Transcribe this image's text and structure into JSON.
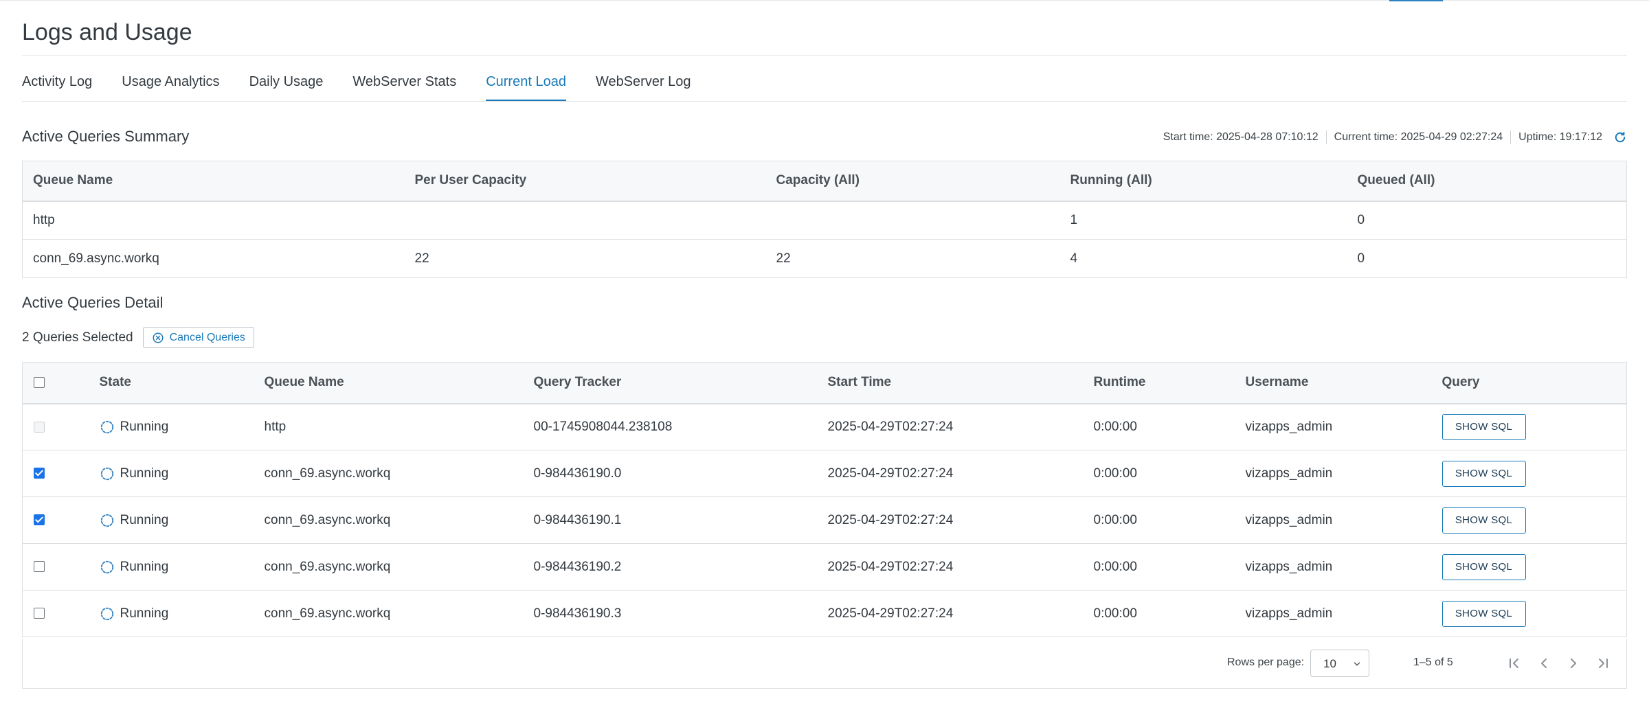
{
  "page": {
    "title": "Logs and Usage"
  },
  "tabs": [
    {
      "label": "Activity Log",
      "active": false
    },
    {
      "label": "Usage Analytics",
      "active": false
    },
    {
      "label": "Daily Usage",
      "active": false
    },
    {
      "label": "WebServer Stats",
      "active": false
    },
    {
      "label": "Current Load",
      "active": true
    },
    {
      "label": "WebServer Log",
      "active": false
    }
  ],
  "summary": {
    "title": "Active Queries Summary",
    "stats": {
      "start_time": "Start time: 2025-04-28 07:10:12",
      "current_time": "Current time: 2025-04-29 02:27:24",
      "uptime": "Uptime: 19:17:12",
      "refresh_icon": "refresh-icon"
    },
    "columns": [
      "Queue Name",
      "Per User Capacity",
      "Capacity (All)",
      "Running (All)",
      "Queued (All)"
    ],
    "rows": [
      [
        "http",
        "",
        "",
        "1",
        "0"
      ],
      [
        "conn_69.async.workq",
        "22",
        "22",
        "4",
        "0"
      ]
    ]
  },
  "detail": {
    "title": "Active Queries Detail",
    "selected_text": "2 Queries Selected",
    "cancel_label": "Cancel Queries",
    "columns": [
      "State",
      "Queue Name",
      "Query Tracker",
      "Start Time",
      "Runtime",
      "Username",
      "Query"
    ],
    "rows": [
      {
        "checked": false,
        "disabled": true,
        "state": "Running",
        "queue": "http",
        "tracker": "00-1745908044.238108",
        "start": "2025-04-29T02:27:24",
        "runtime": "0:00:00",
        "user": "vizapps_admin",
        "action": "SHOW SQL"
      },
      {
        "checked": true,
        "disabled": false,
        "state": "Running",
        "queue": "conn_69.async.workq",
        "tracker": "0-984436190.0",
        "start": "2025-04-29T02:27:24",
        "runtime": "0:00:00",
        "user": "vizapps_admin",
        "action": "SHOW SQL"
      },
      {
        "checked": true,
        "disabled": false,
        "state": "Running",
        "queue": "conn_69.async.workq",
        "tracker": "0-984436190.1",
        "start": "2025-04-29T02:27:24",
        "runtime": "0:00:00",
        "user": "vizapps_admin",
        "action": "SHOW SQL"
      },
      {
        "checked": false,
        "disabled": false,
        "state": "Running",
        "queue": "conn_69.async.workq",
        "tracker": "0-984436190.2",
        "start": "2025-04-29T02:27:24",
        "runtime": "0:00:00",
        "user": "vizapps_admin",
        "action": "SHOW SQL"
      },
      {
        "checked": false,
        "disabled": false,
        "state": "Running",
        "queue": "conn_69.async.workq",
        "tracker": "0-984436190.3",
        "start": "2025-04-29T02:27:24",
        "runtime": "0:00:00",
        "user": "vizapps_admin",
        "action": "SHOW SQL"
      }
    ],
    "pagination": {
      "rows_per_page_label": "Rows per page:",
      "rows_per_page": "10",
      "range": "1–5 of 5"
    }
  },
  "colors": {
    "accent": "#1a7ab8",
    "checkbox": "#1a73e8"
  }
}
